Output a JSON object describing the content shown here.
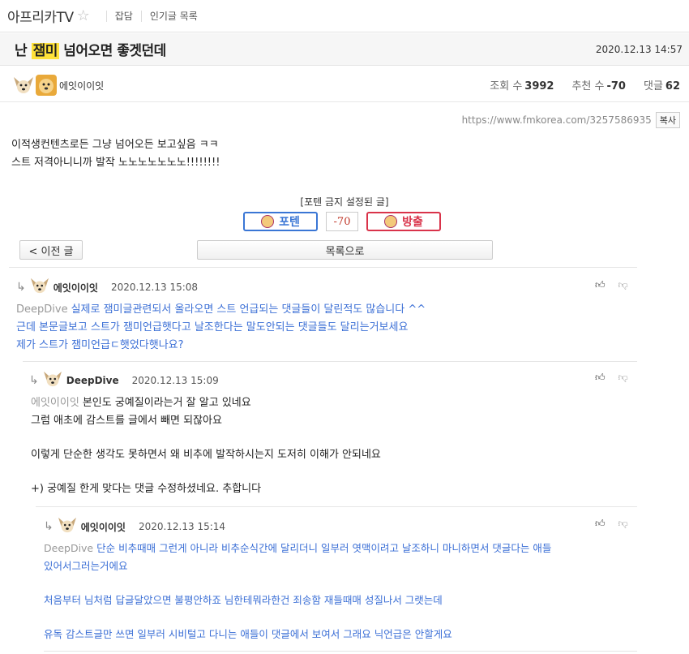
{
  "site": {
    "brand": "아프리카TV",
    "star_icon": "star-icon"
  },
  "nav": {
    "item1": "잡담",
    "item2": "인기글 목록"
  },
  "post": {
    "title_pre": "난 ",
    "title_highlight": "잼미",
    "title_post": " 넘어오면 좋겟던데",
    "date": "2020.12.13 14:57",
    "author": "에잇이이잇",
    "views_label": "조회 수",
    "views": "3992",
    "recommend_label": "추천 수",
    "recommend": "-70",
    "comments_label": "댓글",
    "comments": "62",
    "url": "https://www.fmkorea.com/3257586935",
    "copy_label": "복사",
    "body_line1": "이적생컨텐츠로든 그냥 넘어오든 보고싶음 ㅋㅋ",
    "body_line2": "스트 저격아니니까 발작 노노노노노노노!!!!!!!!"
  },
  "vote": {
    "notice": "[포텐 금지 설정된 글]",
    "up_label": "포텐",
    "count": "-70",
    "down_label": "방출"
  },
  "buttons": {
    "prev": "< 이전 글",
    "list": "목록으로"
  },
  "comments": [
    {
      "author": "에잇이이잇",
      "date": "2020.12.13 15:08",
      "mention": "DeepDive",
      "line1": "실제로 잼미글관련되서 올라오면 스트 언급되는 댓글들이 달린적도 많습니다 ^^",
      "line2": "근데 본문글보고 스트가 잼미언급햇다고 날조한다는 말도안되는 댓글들도 달리는거보세요",
      "line3": "제가 스트가 잼미언급ㄷ햇었다햇나요?"
    },
    {
      "author": "DeepDive",
      "date": "2020.12.13 15:09",
      "mention": "에잇이이잇",
      "line1": "본인도 궁예질이라는거 잘 알고 있네요",
      "line2": "그럼 애초에 감스트를 글에서 빼면 되잖아요",
      "line3": "이렇게 단순한 생각도 못하면서 왜 비추에 발작하시는지 도저히 이해가 안되네요",
      "line4": "+) 궁예질 한게 맞다는 댓글 수정하셨네요. 추합니다"
    },
    {
      "author": "에잇이이잇",
      "date": "2020.12.13 15:14",
      "mention": "DeepDive",
      "line1": "단순 비추때매 그런게 아니라 비추순식간에 달리더니 일부러 엿맥이려고 날조하니 마니하면서 댓글다는 애들",
      "line2": "있어서그러는거에요",
      "line3": "처음부터 님처럼 답글달았으면 불평안하죠 님한테뭐라한건 죄송함 재들때매 성질나서 그랫는데",
      "line4": "유독 감스트글만 쓰면 일부러 시비털고 다니는 애들이 댓글에서 보여서 그래요 닉언급은 안할게요"
    }
  ],
  "colors": {
    "highlight": "#ffe23a",
    "comment_blue": "#3b6fd6",
    "up": "#3a76d5",
    "down": "#d9334a"
  }
}
